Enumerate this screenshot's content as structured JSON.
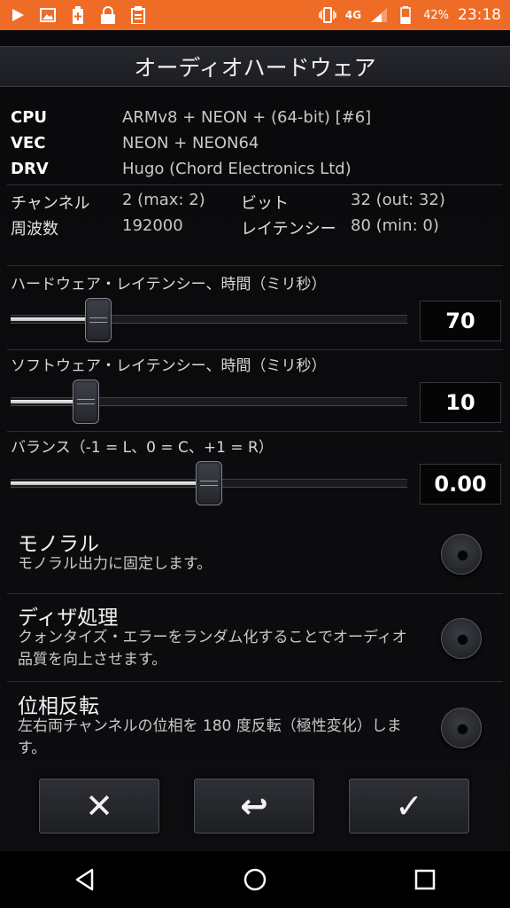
{
  "status_bar": {
    "network": "4G",
    "battery": "42%",
    "time": "23:18",
    "accent": "#ef6c26"
  },
  "dialog": {
    "title": "オーディオハードウェア",
    "info": {
      "cpu_key": "CPU",
      "cpu_val": "ARMv8 + NEON + (64-bit) [#6]",
      "vec_key": "VEC",
      "vec_val": "NEON + NEON64",
      "drv_key": "DRV",
      "drv_val": "Hugo (Chord Electronics Ltd)",
      "channel_key": "チャンネル",
      "channel_val": "2 (max: 2)",
      "bit_key": "ビット",
      "bit_val": "32 (out: 32)",
      "freq_key": "周波数",
      "freq_val": "192000",
      "latency_key": "レイテンシー",
      "latency_val": "80 (min: 0)"
    },
    "sliders": [
      {
        "label": "ハードウェア・レイテンシー、時間（ミリ秒）",
        "value": "70",
        "level": 0.22
      },
      {
        "label": "ソフトウェア・レイテンシー、時間（ミリ秒）",
        "value": "10",
        "level": 0.19
      },
      {
        "label": "バランス（-1 = L、0 = C、+1 = R）",
        "value": "0.00",
        "level": 0.5
      }
    ],
    "options": [
      {
        "title": "モノラル",
        "desc": "モノラル出力に固定します。"
      },
      {
        "title": "ディザ処理",
        "desc": "クォンタイズ・エラーをランダム化することでオーディオ品質を向上させます。"
      },
      {
        "title": "位相反転",
        "desc": "左右両チャンネルの位相を 180 度反転（極性変化）します。"
      }
    ],
    "buttons": {
      "cancel_glyph": "✕",
      "revert_glyph": "↩",
      "ok_glyph": "✓"
    }
  },
  "icons": [
    "play-icon",
    "image-icon",
    "battery-plus-icon",
    "lock-icon",
    "clipboard-icon",
    "vibrate-icon",
    "signal-icon",
    "battery-icon",
    "back-icon",
    "home-icon",
    "recents-icon"
  ]
}
